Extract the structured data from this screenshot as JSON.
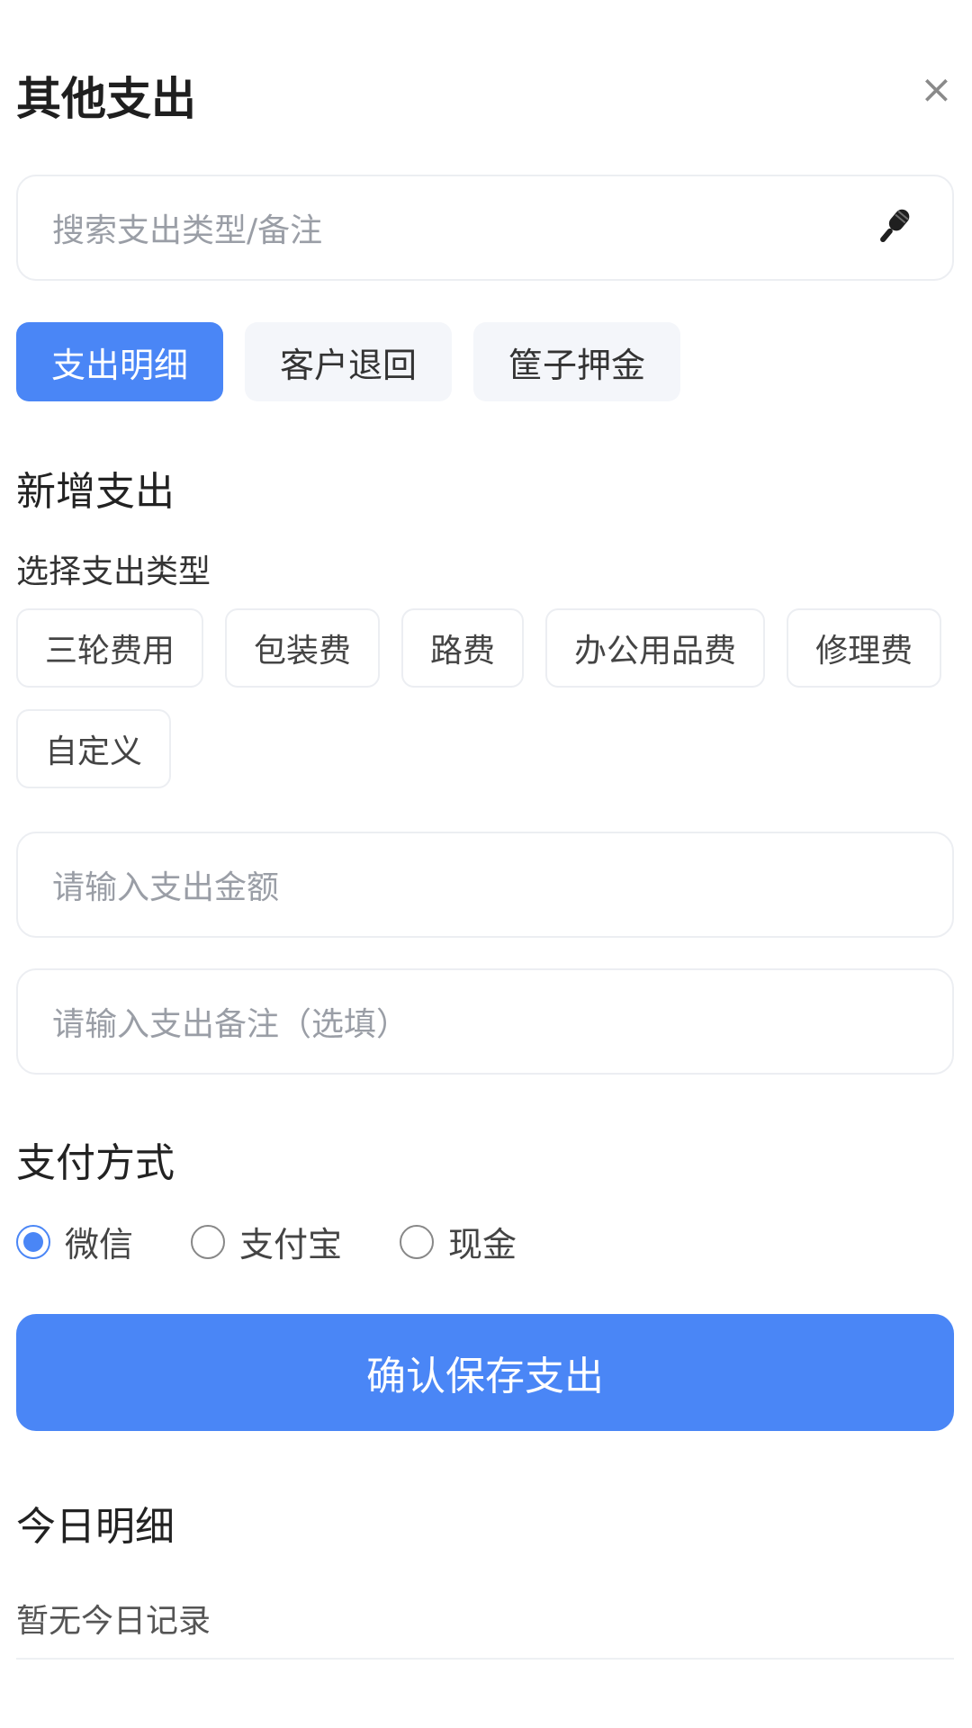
{
  "header": {
    "title": "其他支出",
    "close_label": "×"
  },
  "search": {
    "placeholder": "搜索支出类型/备注",
    "icon": "microphone-icon"
  },
  "tabs": [
    {
      "label": "支出明细",
      "active": true
    },
    {
      "label": "客户退回",
      "active": false
    },
    {
      "label": "筐子押金",
      "active": false
    }
  ],
  "new_expense": {
    "title": "新增支出",
    "type_label": "选择支出类型",
    "types": [
      "三轮费用",
      "包装费",
      "路费",
      "办公用品费",
      "修理费",
      "自定义"
    ],
    "amount_placeholder": "请输入支出金额",
    "note_placeholder": "请输入支出备注（选填）"
  },
  "payment": {
    "title": "支付方式",
    "options": [
      {
        "label": "微信",
        "checked": true
      },
      {
        "label": "支付宝",
        "checked": false
      },
      {
        "label": "现金",
        "checked": false
      }
    ]
  },
  "confirm_label": "确认保存支出",
  "today": {
    "title": "今日明细",
    "empty_text": "暂无今日记录"
  },
  "colors": {
    "accent": "#4a86f6",
    "chip_bg": "#f4f6fa",
    "border": "#eceef2"
  }
}
